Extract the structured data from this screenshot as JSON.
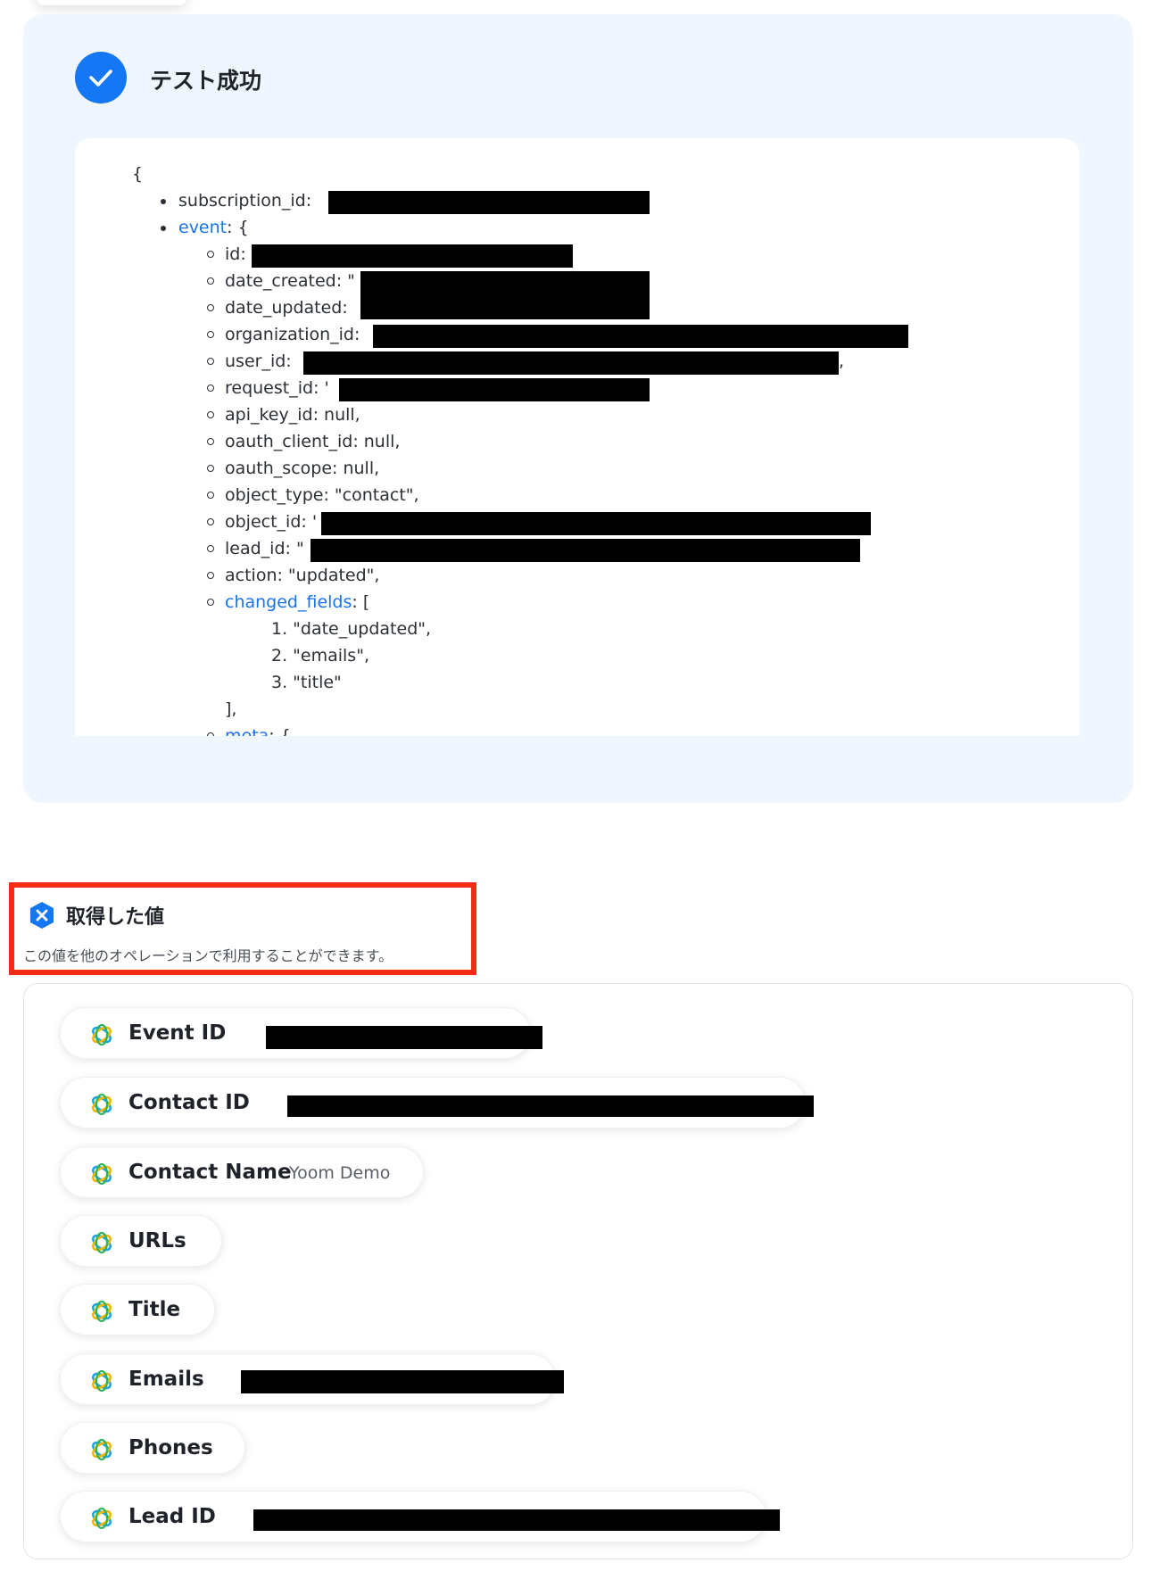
{
  "test_result": {
    "title": "テスト成功",
    "json_lines": {
      "open_brace": "{",
      "subscription_id": "subscription_id:",
      "event_key": "event",
      "event_open": ": {",
      "id": "id:",
      "date_created": "date_created: \"",
      "date_updated": "date_updated:",
      "organization_id": "organization_id:",
      "user_id": "user_id:",
      "user_id_tail": ",",
      "request_id": "request_id: '",
      "api_key_id": "api_key_id: null,",
      "oauth_client_id": "oauth_client_id: null,",
      "oauth_scope": "oauth_scope: null,",
      "object_type": "object_type: \"contact\",",
      "object_id": "object_id: '",
      "lead_id": "lead_id: \"",
      "action": "action: \"updated\",",
      "changed_fields_key": "changed_fields",
      "changed_fields_open": ": [",
      "changed_fields_items": [
        "1. \"date_updated\",",
        "2. \"emails\",",
        "3. \"title\""
      ],
      "changed_fields_close": "],",
      "meta_key": "meta",
      "meta_open": ": {"
    }
  },
  "acquired_values": {
    "title": "取得した値",
    "subtitle": "この値を他のオペレーションで利用することができます。",
    "items": [
      {
        "label": "Event ID",
        "value": ""
      },
      {
        "label": "Contact ID",
        "value": ""
      },
      {
        "label": "Contact Name",
        "value": "Yoom Demo"
      },
      {
        "label": "URLs",
        "value": ""
      },
      {
        "label": "Title",
        "value": ""
      },
      {
        "label": "Emails",
        "value": ""
      },
      {
        "label": "Phones",
        "value": ""
      },
      {
        "label": "Lead ID",
        "value": ""
      }
    ]
  },
  "colors": {
    "accent_blue": "#1677f5",
    "highlight_red": "#f42b17",
    "panel_bg": "#eff6fe"
  },
  "icons": {
    "success": "check-icon",
    "acquired": "yoom-x-badge-icon",
    "value_item": "attio-logo-icon"
  }
}
